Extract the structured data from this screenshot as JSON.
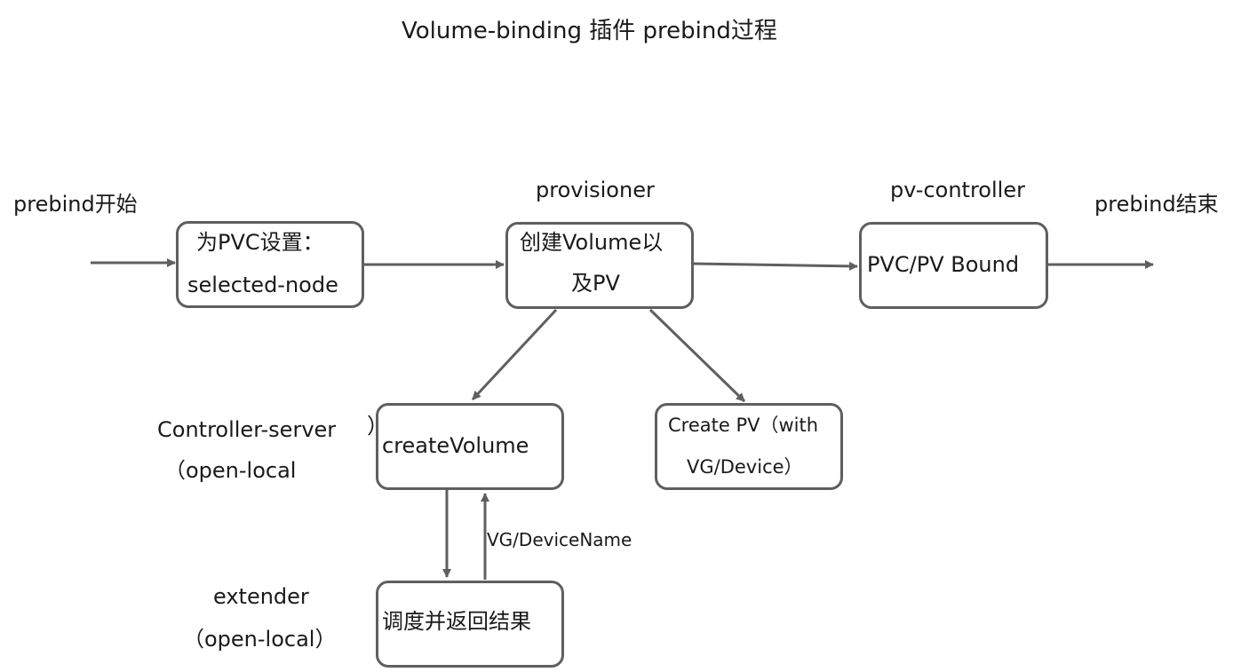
{
  "diagram": {
    "title": "Volume-binding 插件 prebind过程",
    "start_label": "prebind开始",
    "end_label": "prebind结束",
    "nodes": {
      "set_pvc": {
        "line1": "为PVC设置：",
        "line2": "selected-node"
      },
      "create_volume_pv": {
        "line1": "创建Volume以",
        "line2": "及PV"
      },
      "bound": {
        "line1": "PVC/PV Bound"
      },
      "create_volume": {
        "line1": "createVolume"
      },
      "create_pv": {
        "line1": "Create PV（with",
        "line2": "VG/Device）"
      },
      "schedule": {
        "line1": "调度并返回结果"
      }
    },
    "lanes": {
      "provisioner": "provisioner",
      "pv_controller": "pv-controller",
      "controller_server": {
        "line1": "Controller-server",
        "line1_suffix": "）",
        "line2": "（open-local"
      },
      "extender": {
        "line1": "extender",
        "line2": "（open-local）"
      }
    },
    "edge_labels": {
      "return_value": "VG/DeviceName"
    },
    "colors": {
      "stroke": "#5f5f5f",
      "text": "#1a1a1a",
      "background": "#ffffff"
    }
  }
}
